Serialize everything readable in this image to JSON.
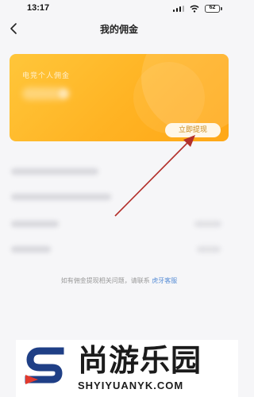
{
  "status_bar": {
    "time": "13:17",
    "battery": "62"
  },
  "nav": {
    "title": "我的佣金",
    "back_icon": "chevron-left-icon"
  },
  "card": {
    "label": "电竞个人佣金",
    "withdraw_label": "立即提现",
    "gradient_start": "#ffc63a",
    "gradient_end": "#ffa716"
  },
  "annotation": {
    "arrow_color": "#b3302b"
  },
  "footer": {
    "contact_text": "如有佣金提现相关问题，请联系 ",
    "contact_link": "虎牙客服"
  },
  "watermark": {
    "name": "尚游乐园",
    "url": "SHYIYUANYK.COM",
    "brand_blue": "#1f3f86",
    "brand_red": "#e23a2e"
  }
}
